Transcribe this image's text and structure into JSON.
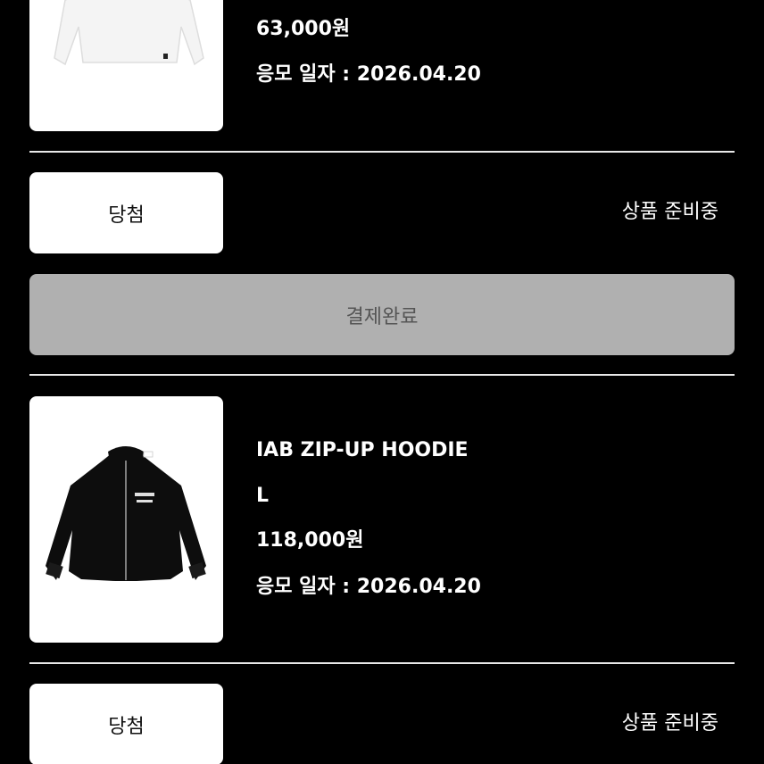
{
  "items": [
    {
      "price": "63,000원",
      "entry_date": "응모 일자 : 2026.04.20",
      "image_icon": "white-hoodie",
      "result": "당첨",
      "status": "상품 준비중"
    },
    {
      "name": "IAB ZIP-UP HOODIE",
      "size": "L",
      "price": "118,000원",
      "entry_date": "응모 일자 : 2026.04.20",
      "image_icon": "black-zip-up-hoodie",
      "result": "당첨",
      "status": "상품 준비중"
    }
  ],
  "payment_button_label": "결제완료",
  "colors": {
    "background": "#000000",
    "card": "#ffffff",
    "button_disabled": "#b0b0b0",
    "button_text": "#555555"
  }
}
